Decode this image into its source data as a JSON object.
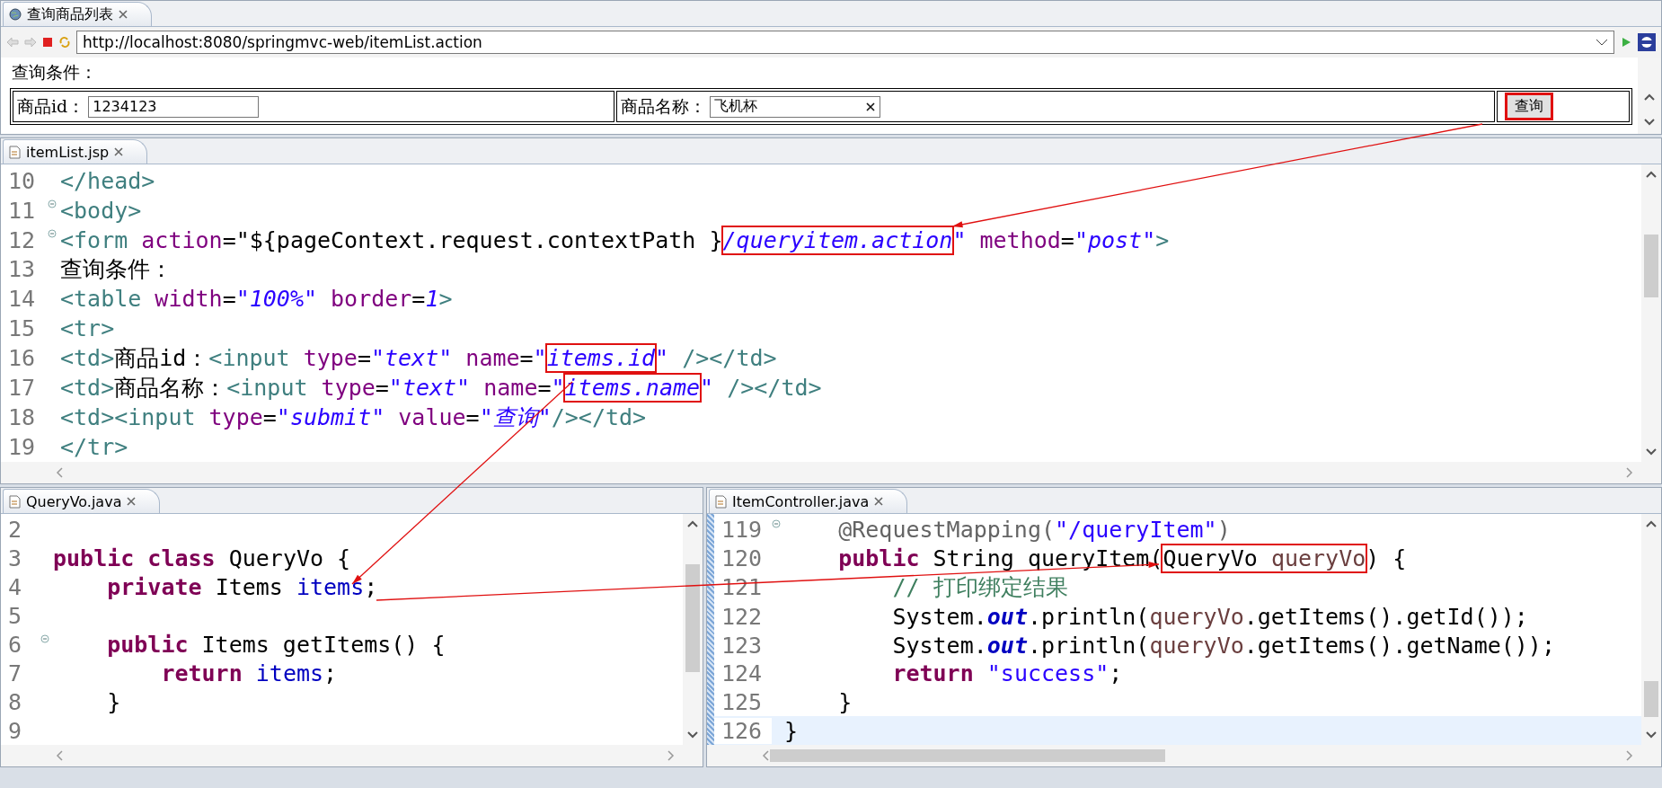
{
  "browser": {
    "tab": {
      "title": "查询商品列表"
    },
    "url": "http://localhost:8080/springmvc-web/itemList.action",
    "page": {
      "heading": "查询条件：",
      "fields": [
        {
          "label": "商品id：",
          "value": "1234123",
          "clearable": false
        },
        {
          "label": "商品名称：",
          "value": "飞机杯",
          "clearable": true
        }
      ],
      "submit_button": {
        "label": "查询",
        "highlighted": true
      }
    }
  },
  "editors": [
    {
      "tab": "itemList.jsp",
      "lines": [
        {
          "number": "10",
          "fold": false,
          "current": false,
          "tokens": [
            {
              "kind": "tag",
              "text": "</head>"
            }
          ]
        },
        {
          "number": "11",
          "fold": true,
          "current": false,
          "tokens": [
            {
              "kind": "tag",
              "text": "<body>"
            }
          ]
        },
        {
          "number": "12",
          "fold": true,
          "current": false,
          "tokens": [
            {
              "kind": "tag",
              "text": "<form"
            },
            {
              "kind": "attr",
              "text": " action"
            },
            {
              "kind": "plain",
              "text": "=\"${pageContext.request.contextPath }"
            },
            {
              "kind": "highlight",
              "tokens": [
                {
                  "kind": "attr_value",
                  "text": "/queryitem.action"
                }
              ]
            },
            {
              "kind": "attr_value",
              "text": "\""
            },
            {
              "kind": "attr",
              "text": " method"
            },
            {
              "kind": "plain",
              "text": "="
            },
            {
              "kind": "attr_value",
              "text": "\"post\""
            },
            {
              "kind": "tag",
              "text": ">"
            }
          ]
        },
        {
          "number": "13",
          "fold": false,
          "current": false,
          "tokens": [
            {
              "kind": "plain",
              "text": "查询条件："
            }
          ]
        },
        {
          "number": "14",
          "fold": false,
          "current": false,
          "tokens": [
            {
              "kind": "tag",
              "text": "<table"
            },
            {
              "kind": "attr",
              "text": " width"
            },
            {
              "kind": "plain",
              "text": "="
            },
            {
              "kind": "attr_value",
              "text": "\"100%\""
            },
            {
              "kind": "attr",
              "text": " border"
            },
            {
              "kind": "plain",
              "text": "="
            },
            {
              "kind": "attr_value",
              "text": "1"
            },
            {
              "kind": "tag",
              "text": ">"
            }
          ]
        },
        {
          "number": "15",
          "fold": false,
          "current": false,
          "tokens": [
            {
              "kind": "tag",
              "text": "<tr>"
            }
          ]
        },
        {
          "number": "16",
          "fold": false,
          "current": false,
          "tokens": [
            {
              "kind": "tag",
              "text": "<td>"
            },
            {
              "kind": "plain",
              "text": "商品id："
            },
            {
              "kind": "tag",
              "text": "<input"
            },
            {
              "kind": "attr",
              "text": " type"
            },
            {
              "kind": "plain",
              "text": "="
            },
            {
              "kind": "attr_value",
              "text": "\"text\""
            },
            {
              "kind": "attr",
              "text": " name"
            },
            {
              "kind": "plain",
              "text": "="
            },
            {
              "kind": "attr_value",
              "text": "\""
            },
            {
              "kind": "highlight",
              "tokens": [
                {
                  "kind": "attr_value",
                  "text": "items.id"
                }
              ]
            },
            {
              "kind": "attr_value",
              "text": "\""
            },
            {
              "kind": "tag",
              "text": " /></td>"
            }
          ]
        },
        {
          "number": "17",
          "fold": false,
          "current": false,
          "tokens": [
            {
              "kind": "tag",
              "text": "<td>"
            },
            {
              "kind": "plain",
              "text": "商品名称："
            },
            {
              "kind": "tag",
              "text": "<input"
            },
            {
              "kind": "attr",
              "text": " type"
            },
            {
              "kind": "plain",
              "text": "="
            },
            {
              "kind": "attr_value",
              "text": "\"text\""
            },
            {
              "kind": "attr",
              "text": " name"
            },
            {
              "kind": "plain",
              "text": "="
            },
            {
              "kind": "attr_value",
              "text": "\""
            },
            {
              "kind": "highlight",
              "tokens": [
                {
                  "kind": "attr_value",
                  "text": "items.name"
                }
              ]
            },
            {
              "kind": "attr_value",
              "text": "\""
            },
            {
              "kind": "tag",
              "text": " /></td>"
            }
          ]
        },
        {
          "number": "18",
          "fold": false,
          "current": false,
          "tokens": [
            {
              "kind": "tag",
              "text": "<td><input"
            },
            {
              "kind": "attr",
              "text": " type"
            },
            {
              "kind": "plain",
              "text": "="
            },
            {
              "kind": "attr_value",
              "text": "\"submit\""
            },
            {
              "kind": "attr",
              "text": " value"
            },
            {
              "kind": "plain",
              "text": "="
            },
            {
              "kind": "attr_value",
              "text": "\"查询\""
            },
            {
              "kind": "tag",
              "text": "/></td>"
            }
          ]
        },
        {
          "number": "19",
          "fold": false,
          "current": false,
          "tokens": [
            {
              "kind": "tag",
              "text": "</tr>"
            }
          ]
        }
      ]
    },
    {
      "tab": "QueryVo.java",
      "lines": [
        {
          "number": "2",
          "fold": false,
          "current": false
        },
        {
          "number": "3",
          "fold": false,
          "current": false,
          "tokens": [
            {
              "kind": "keyword",
              "text": "public class"
            },
            {
              "kind": "plain",
              "text": " QueryVo {"
            }
          ]
        },
        {
          "number": "4",
          "fold": false,
          "current": false,
          "tokens": [
            {
              "kind": "keyword",
              "text": "    private"
            },
            {
              "kind": "plain",
              "text": " Items "
            },
            {
              "kind": "field",
              "text": "items"
            },
            {
              "kind": "plain",
              "text": ";"
            }
          ]
        },
        {
          "number": "5",
          "fold": false,
          "current": false
        },
        {
          "number": "6",
          "fold": true,
          "current": false,
          "tokens": [
            {
              "kind": "keyword",
              "text": "    public"
            },
            {
              "kind": "plain",
              "text": " Items getItems() {"
            }
          ]
        },
        {
          "number": "7",
          "fold": false,
          "current": false,
          "tokens": [
            {
              "kind": "keyword",
              "text": "        return "
            },
            {
              "kind": "field",
              "text": "items"
            },
            {
              "kind": "plain",
              "text": ";"
            }
          ]
        },
        {
          "number": "8",
          "fold": false,
          "current": false,
          "tokens": [
            {
              "kind": "plain",
              "text": "    }"
            }
          ]
        },
        {
          "number": "9",
          "fold": false,
          "current": false
        }
      ]
    },
    {
      "tab": "ItemController.java",
      "lines": [
        {
          "number": "119",
          "fold": true,
          "current": false,
          "tokens": [
            {
              "kind": "annotation",
              "text": "    @RequestMapping("
            },
            {
              "kind": "string",
              "text": "\"/queryItem\""
            },
            {
              "kind": "annotation",
              "text": ")"
            }
          ]
        },
        {
          "number": "120",
          "fold": false,
          "current": false,
          "tokens": [
            {
              "kind": "keyword",
              "text": "    public"
            },
            {
              "kind": "plain",
              "text": " String queryItem("
            },
            {
              "kind": "highlight",
              "tokens": [
                {
                  "kind": "plain",
                  "text": "QueryVo "
                },
                {
                  "kind": "local",
                  "text": "queryVo"
                }
              ]
            },
            {
              "kind": "plain",
              "text": ") {"
            }
          ]
        },
        {
          "number": "121",
          "fold": false,
          "current": false,
          "tokens": [
            {
              "kind": "comment",
              "text": "        // 打印绑定结果"
            }
          ]
        },
        {
          "number": "122",
          "fold": false,
          "current": false,
          "tokens": [
            {
              "kind": "plain",
              "text": "        System."
            },
            {
              "kind": "static",
              "text": "out"
            },
            {
              "kind": "plain",
              "text": ".println("
            },
            {
              "kind": "local",
              "text": "queryVo"
            },
            {
              "kind": "plain",
              "text": ".getItems().getId());"
            }
          ]
        },
        {
          "number": "123",
          "fold": false,
          "current": false,
          "tokens": [
            {
              "kind": "plain",
              "text": "        System."
            },
            {
              "kind": "static",
              "text": "out"
            },
            {
              "kind": "plain",
              "text": ".println("
            },
            {
              "kind": "local",
              "text": "queryVo"
            },
            {
              "kind": "plain",
              "text": ".getItems().getName());"
            }
          ]
        },
        {
          "number": "124",
          "fold": false,
          "current": false,
          "tokens": [
            {
              "kind": "keyword",
              "text": "        return "
            },
            {
              "kind": "string",
              "text": "\"success\""
            },
            {
              "kind": "plain",
              "text": ";"
            }
          ]
        },
        {
          "number": "125",
          "fold": false,
          "current": false,
          "tokens": [
            {
              "kind": "plain",
              "text": "    }"
            }
          ]
        },
        {
          "number": "126",
          "fold": false,
          "current": true,
          "tokens": [
            {
              "kind": "plain",
              "text": "}"
            }
          ]
        }
      ]
    }
  ]
}
